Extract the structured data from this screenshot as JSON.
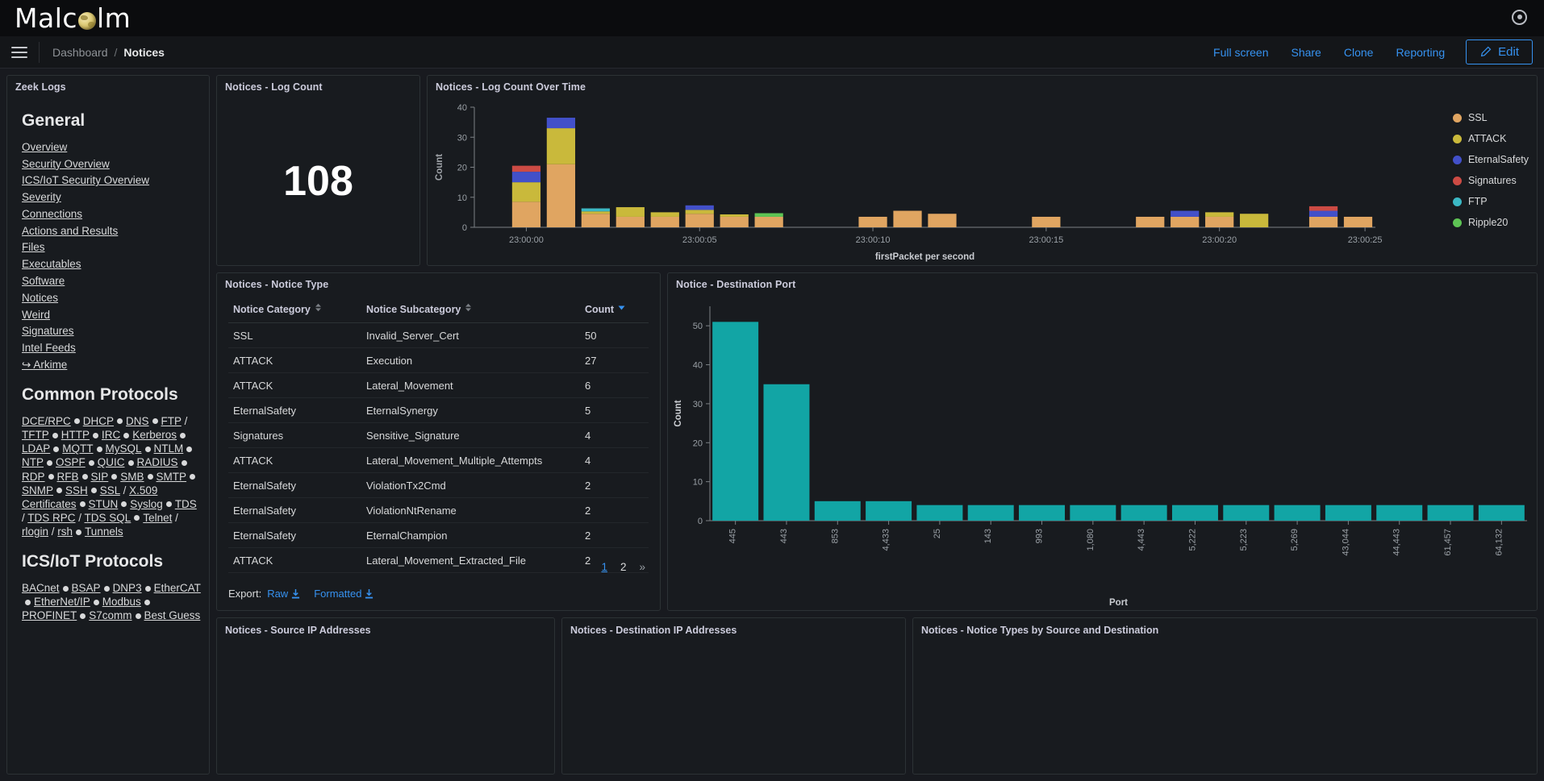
{
  "brand": {
    "name_part1": "Malc",
    "name_part2": "lm",
    "globe_icon": "globe-icon",
    "settings_icon": "gear-icon"
  },
  "nav": {
    "menu_icon": "hamburger-icon",
    "breadcrumb_root": "Dashboard",
    "breadcrumb_current": "Notices",
    "links": [
      "Full screen",
      "Share",
      "Clone",
      "Reporting"
    ],
    "edit_label": "Edit",
    "edit_icon": "pencil-icon",
    "accent": "#3692f0"
  },
  "sidebar": {
    "title": "Zeek Logs",
    "general_heading": "General",
    "general_links": [
      "Overview",
      "Security Overview",
      "ICS/IoT Security Overview",
      "Severity",
      "Connections",
      "Actions and Results",
      "Files",
      "Executables",
      "Software",
      "Notices",
      "Weird",
      "Signatures",
      "Intel Feeds",
      "↪ Arkime"
    ],
    "common_heading": "Common Protocols",
    "common_protocols": [
      "DCE/RPC",
      "DHCP",
      "DNS",
      "FTP / TFTP",
      "HTTP",
      "IRC",
      "Kerberos",
      "LDAP",
      "MQTT",
      "MySQL",
      "NTLM",
      "NTP",
      "OSPF",
      "QUIC",
      "RADIUS",
      "RDP",
      "RFB",
      "SIP",
      "SMB",
      "SMTP",
      "SNMP",
      "SSH",
      "SSL / X.509 Certificates",
      "STUN",
      "Syslog",
      "TDS / TDS RPC / TDS SQL",
      "Telnet / rlogin / rsh",
      "Tunnels"
    ],
    "ics_heading": "ICS/IoT Protocols",
    "ics_protocols": [
      "BACnet",
      "BSAP",
      "DNP3",
      "EtherCAT",
      "EtherNet/IP",
      "Modbus",
      "PROFINET",
      "S7comm",
      "Best Guess"
    ]
  },
  "panels": {
    "log_count": {
      "title": "Notices - Log Count",
      "value": "108"
    },
    "log_count_over_time": {
      "title": "Notices - Log Count Over Time"
    },
    "notice_type": {
      "title": "Notices - Notice Type"
    },
    "destination_port": {
      "title": "Notice - Destination Port"
    },
    "source_ip": {
      "title": "Notices - Source IP Addresses"
    },
    "dest_ip": {
      "title": "Notices - Destination IP Addresses"
    },
    "types_by_src_dst": {
      "title": "Notices - Notice Types by Source and Destination"
    }
  },
  "notice_table": {
    "columns": [
      "Notice Category",
      "Notice Subcategory",
      "Count"
    ],
    "sorted_column": "Count",
    "rows": [
      [
        "SSL",
        "Invalid_Server_Cert",
        "50"
      ],
      [
        "ATTACK",
        "Execution",
        "27"
      ],
      [
        "ATTACK",
        "Lateral_Movement",
        "6"
      ],
      [
        "EternalSafety",
        "EternalSynergy",
        "5"
      ],
      [
        "Signatures",
        "Sensitive_Signature",
        "4"
      ],
      [
        "ATTACK",
        "Lateral_Movement_Multiple_Attempts",
        "4"
      ],
      [
        "EternalSafety",
        "ViolationTx2Cmd",
        "2"
      ],
      [
        "EternalSafety",
        "ViolationNtRename",
        "2"
      ],
      [
        "EternalSafety",
        "EternalChampion",
        "2"
      ],
      [
        "ATTACK",
        "Lateral_Movement_Extracted_File",
        "2"
      ]
    ],
    "export_label": "Export:",
    "export_raw": "Raw",
    "export_formatted": "Formatted",
    "download_icon": "download-icon",
    "pages": [
      "1",
      "2"
    ],
    "next_page": "»",
    "current_page": "1"
  },
  "chart_data": [
    {
      "type": "bar",
      "stacked": true,
      "title": "Notices - Log Count Over Time",
      "xlabel": "firstPacket per second",
      "ylabel": "Count",
      "ylim": [
        0,
        40
      ],
      "yticks": [
        0,
        10,
        20,
        30,
        40
      ],
      "xticks": [
        "23:00:00",
        "23:00:05",
        "23:00:10",
        "23:00:15",
        "23:00:20",
        "23:00:25"
      ],
      "legend_position": "right",
      "series": [
        {
          "name": "SSL",
          "color": "#e0a561",
          "values": [
            0,
            8.5,
            21,
            4.5,
            3.5,
            3.5,
            4.5,
            3.5,
            3.5,
            0,
            0,
            3.5,
            5.5,
            4.5,
            0,
            0,
            3.5,
            0,
            0,
            3.5,
            3.5,
            3.5,
            0,
            0,
            3.5,
            3.5
          ]
        },
        {
          "name": "ATTACK",
          "color": "#c9b93b",
          "values": [
            0,
            6.5,
            12,
            0.8,
            3.2,
            1.5,
            1.3,
            0.8,
            0,
            0,
            0,
            0,
            0,
            0,
            0,
            0,
            0,
            0,
            0,
            0,
            0,
            1.5,
            4.5,
            0,
            0,
            0
          ]
        },
        {
          "name": "EternalSafety",
          "color": "#4250c9",
          "values": [
            0,
            3.5,
            3.5,
            0,
            0,
            0,
            1.5,
            0,
            0,
            0,
            0,
            0,
            0,
            0,
            0,
            0,
            0,
            0,
            0,
            0,
            2,
            0,
            0,
            0,
            2,
            0
          ]
        },
        {
          "name": "Signatures",
          "color": "#cc4b44",
          "values": [
            0,
            2,
            0,
            0,
            0,
            0,
            0,
            0,
            0,
            0,
            0,
            0,
            0,
            0,
            0,
            0,
            0,
            0,
            0,
            0,
            0,
            0,
            0,
            0,
            1.5,
            0
          ]
        },
        {
          "name": "FTP",
          "color": "#3bb8c4",
          "values": [
            0,
            0,
            0,
            1,
            0,
            0,
            0,
            0,
            0,
            0,
            0,
            0,
            0,
            0,
            0,
            0,
            0,
            0,
            0,
            0,
            0,
            0,
            0,
            0,
            0,
            0
          ]
        },
        {
          "name": "Ripple20",
          "color": "#5ec454",
          "values": [
            0,
            0,
            0,
            0,
            0,
            0,
            0,
            0,
            1.2,
            0,
            0,
            0,
            0,
            0,
            0,
            0,
            0,
            0,
            0,
            0,
            0,
            0,
            0,
            0,
            0,
            0
          ]
        }
      ],
      "legend": [
        "SSL",
        "ATTACK",
        "EternalSafety",
        "Signatures",
        "FTP",
        "Ripple20"
      ]
    },
    {
      "type": "bar",
      "title": "Notice - Destination Port",
      "xlabel": "Port",
      "ylabel": "Count",
      "ylim": [
        0,
        55
      ],
      "yticks": [
        0,
        10,
        20,
        30,
        40,
        50
      ],
      "bar_color": "#12a5a5",
      "categories": [
        "445",
        "443",
        "853",
        "4,433",
        "25",
        "143",
        "993",
        "1,080",
        "4,443",
        "5,222",
        "5,223",
        "5,269",
        "43,044",
        "44,443",
        "61,457",
        "64,132"
      ],
      "values": [
        51,
        35,
        5,
        5,
        4,
        4,
        4,
        4,
        4,
        4,
        4,
        4,
        4,
        4,
        4,
        4
      ]
    }
  ]
}
